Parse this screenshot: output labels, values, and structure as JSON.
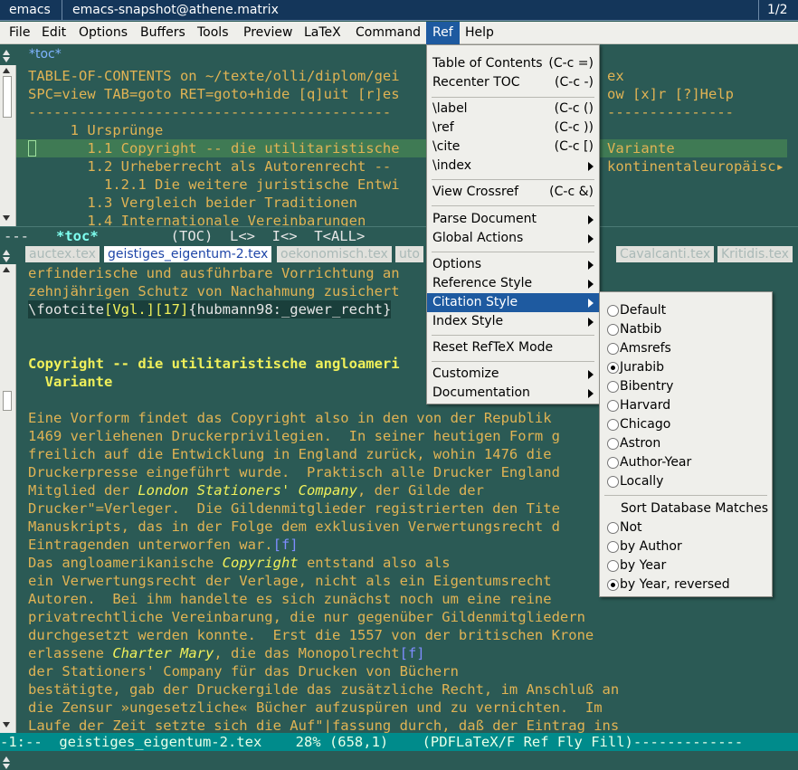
{
  "titlebar": {
    "tab1": "emacs",
    "tab2": "emacs-snapshot@athene.matrix",
    "pager": "1/2"
  },
  "menubar": {
    "items": [
      "File",
      "Edit",
      "Options",
      "Buffers",
      "Tools",
      "Preview",
      "LaTeX",
      "Command",
      "Ref",
      "Help"
    ]
  },
  "toc_window": {
    "label": "*toc*",
    "lines": [
      "TABLE-OF-CONTENTS on ~/texte/olli/diplom/gei",
      "SPC=view TAB=goto RET=goto+hide [q]uit [r]es",
      "-------------------------------------------",
      "     1 Ursprünge",
      "       1.1 Copyright -- die utilitaristische",
      "       1.2 Urheberrecht als Autorenrecht --",
      "         1.2.1 Die weitere juristische Entwi",
      "       1.3 Vergleich beider Traditionen",
      "       1.4 Internationale Vereinbarungen"
    ],
    "right_lines": [
      "ex",
      "ow [x]r [?]Help",
      "---------------",
      "",
      "Variante",
      "kontinentaleuropäisc▸"
    ],
    "mode_line": {
      "dashes": "---",
      "name": "*toc*",
      "tail": "     (TOC)  L<>  I<>  T<ALL>"
    }
  },
  "tabs": [
    "auctex.tex",
    "geistiges_eigentum-2.tex",
    "oekonomisch.tex",
    "uto",
    "Cavalcanti.tex",
    "Kritidis.tex"
  ],
  "main_window": {
    "lines": [
      {
        "t": "erfinderische und ausführbare Vorrichtung an",
        "c": "ora"
      },
      {
        "t": "zehnjährigen Schutz von Nachahmung zusichert",
        "c": "ora"
      },
      {
        "t": "\\footcite[Vgl.][17]{hubmann98:_gewer_recht}",
        "c": "wht"
      },
      {
        "t": "",
        "c": "ora"
      },
      {
        "t": "Copyright -- die utilitaristische angloameri",
        "c": "yel"
      },
      {
        "t": "  Variante",
        "c": "yel"
      },
      {
        "t": "",
        "c": "ora"
      },
      {
        "t": "Eine Vorform findet das Copyright also in den von der Republik",
        "c": "ora"
      },
      {
        "t": "1469 verliehenen Druckerprivilegien.  In seiner heutigen Form g",
        "c": "ora"
      },
      {
        "t": "freilich auf die Entwicklung in England zurück, wohin 1476 die",
        "c": "ora"
      },
      {
        "t": "Druckerpresse eingeführt wurde.  Praktisch alle Drucker England",
        "c": "ora"
      },
      {
        "t": "Mitglied der London Stationers' Company, der Gilde der",
        "c": "ora"
      },
      {
        "t": "Drucker\"=Verleger.  Die Gildenmitglieder registrierten den Tite",
        "c": "ora"
      },
      {
        "t": "Manuskripts, das in der Folge dem exklusiven Verwertungsrecht d",
        "c": "ora"
      },
      {
        "t": "Eintragenden unterworfen war.[f]",
        "c": "ora"
      },
      {
        "t": "Das angloamerikanische Copyright entstand also als",
        "c": "ora"
      },
      {
        "t": "ein Verwertungsrecht der Verlage, nicht als ein Eigentumsrecht",
        "c": "ora"
      },
      {
        "t": "Autoren.  Bei ihm handelte es sich zunächst noch um eine reine",
        "c": "ora"
      },
      {
        "t": "privatrechtliche Vereinbarung, die nur gegenüber Gildenmitgliedern",
        "c": "ora"
      },
      {
        "t": "durchgesetzt werden konnte.  Erst die 1557 von der britischen Krone",
        "c": "ora"
      },
      {
        "t": "erlassene Charter Mary, die das Monopolrecht[f]",
        "c": "ora"
      },
      {
        "t": "der Stationers' Company für das Drucken von Büchern",
        "c": "ora"
      },
      {
        "t": "bestätigte, gab der Druckergilde das zusätzliche Recht, im Anschluß an",
        "c": "ora"
      },
      {
        "t": "die Zensur »ungesetzliche« Bücher aufzuspüren und zu vernichten.  Im",
        "c": "ora"
      },
      {
        "t": "Laufe der Zeit setzte sich die Auf\"|fassung durch, daß der Eintrag ins",
        "c": "ora"
      }
    ],
    "mode_line": "-1:--  geistiges_eigentum-2.tex    28% (658,1)    (PDFLaTeX/F Ref Fly Fill)-------------"
  },
  "ref_menu": {
    "items": [
      {
        "label": "Table of Contents",
        "shortcut": "(C-c =)"
      },
      {
        "label": "Recenter TOC",
        "shortcut": "(C-c -)"
      },
      {
        "sep": true
      },
      {
        "label": "\\label",
        "shortcut": "(C-c ()"
      },
      {
        "label": "\\ref",
        "shortcut": "(C-c ))"
      },
      {
        "label": "\\cite",
        "shortcut": "(C-c [)"
      },
      {
        "label": "\\index",
        "submenu": true
      },
      {
        "sep": true
      },
      {
        "label": "View Crossref",
        "shortcut": "(C-c &)"
      },
      {
        "sep": true
      },
      {
        "label": "Parse Document",
        "submenu": true
      },
      {
        "label": "Global Actions",
        "submenu": true
      },
      {
        "sep": true
      },
      {
        "label": "Options",
        "submenu": true
      },
      {
        "label": "Reference Style",
        "submenu": true
      },
      {
        "label": "Citation Style",
        "submenu": true,
        "selected": true
      },
      {
        "label": "Index Style",
        "submenu": true
      },
      {
        "sep": true
      },
      {
        "label": "Reset RefTeX Mode"
      },
      {
        "sep": true
      },
      {
        "label": "Customize",
        "submenu": true
      },
      {
        "label": "Documentation",
        "submenu": true
      }
    ]
  },
  "citation_submenu": {
    "styles": [
      {
        "label": "Default",
        "checked": false
      },
      {
        "label": "Natbib",
        "checked": false
      },
      {
        "label": "Amsrefs",
        "checked": false
      },
      {
        "label": "Jurabib",
        "checked": true
      },
      {
        "label": "Bibentry",
        "checked": false
      },
      {
        "label": "Harvard",
        "checked": false
      },
      {
        "label": "Chicago",
        "checked": false
      },
      {
        "label": "Astron",
        "checked": false
      },
      {
        "label": "Author-Year",
        "checked": false
      },
      {
        "label": "Locally",
        "checked": false
      }
    ],
    "sort_header": "Sort Database Matches",
    "sort": [
      {
        "label": "Not",
        "checked": false
      },
      {
        "label": "by Author",
        "checked": false
      },
      {
        "label": "by Year",
        "checked": false
      },
      {
        "label": "by Year, reversed",
        "checked": true
      }
    ]
  }
}
